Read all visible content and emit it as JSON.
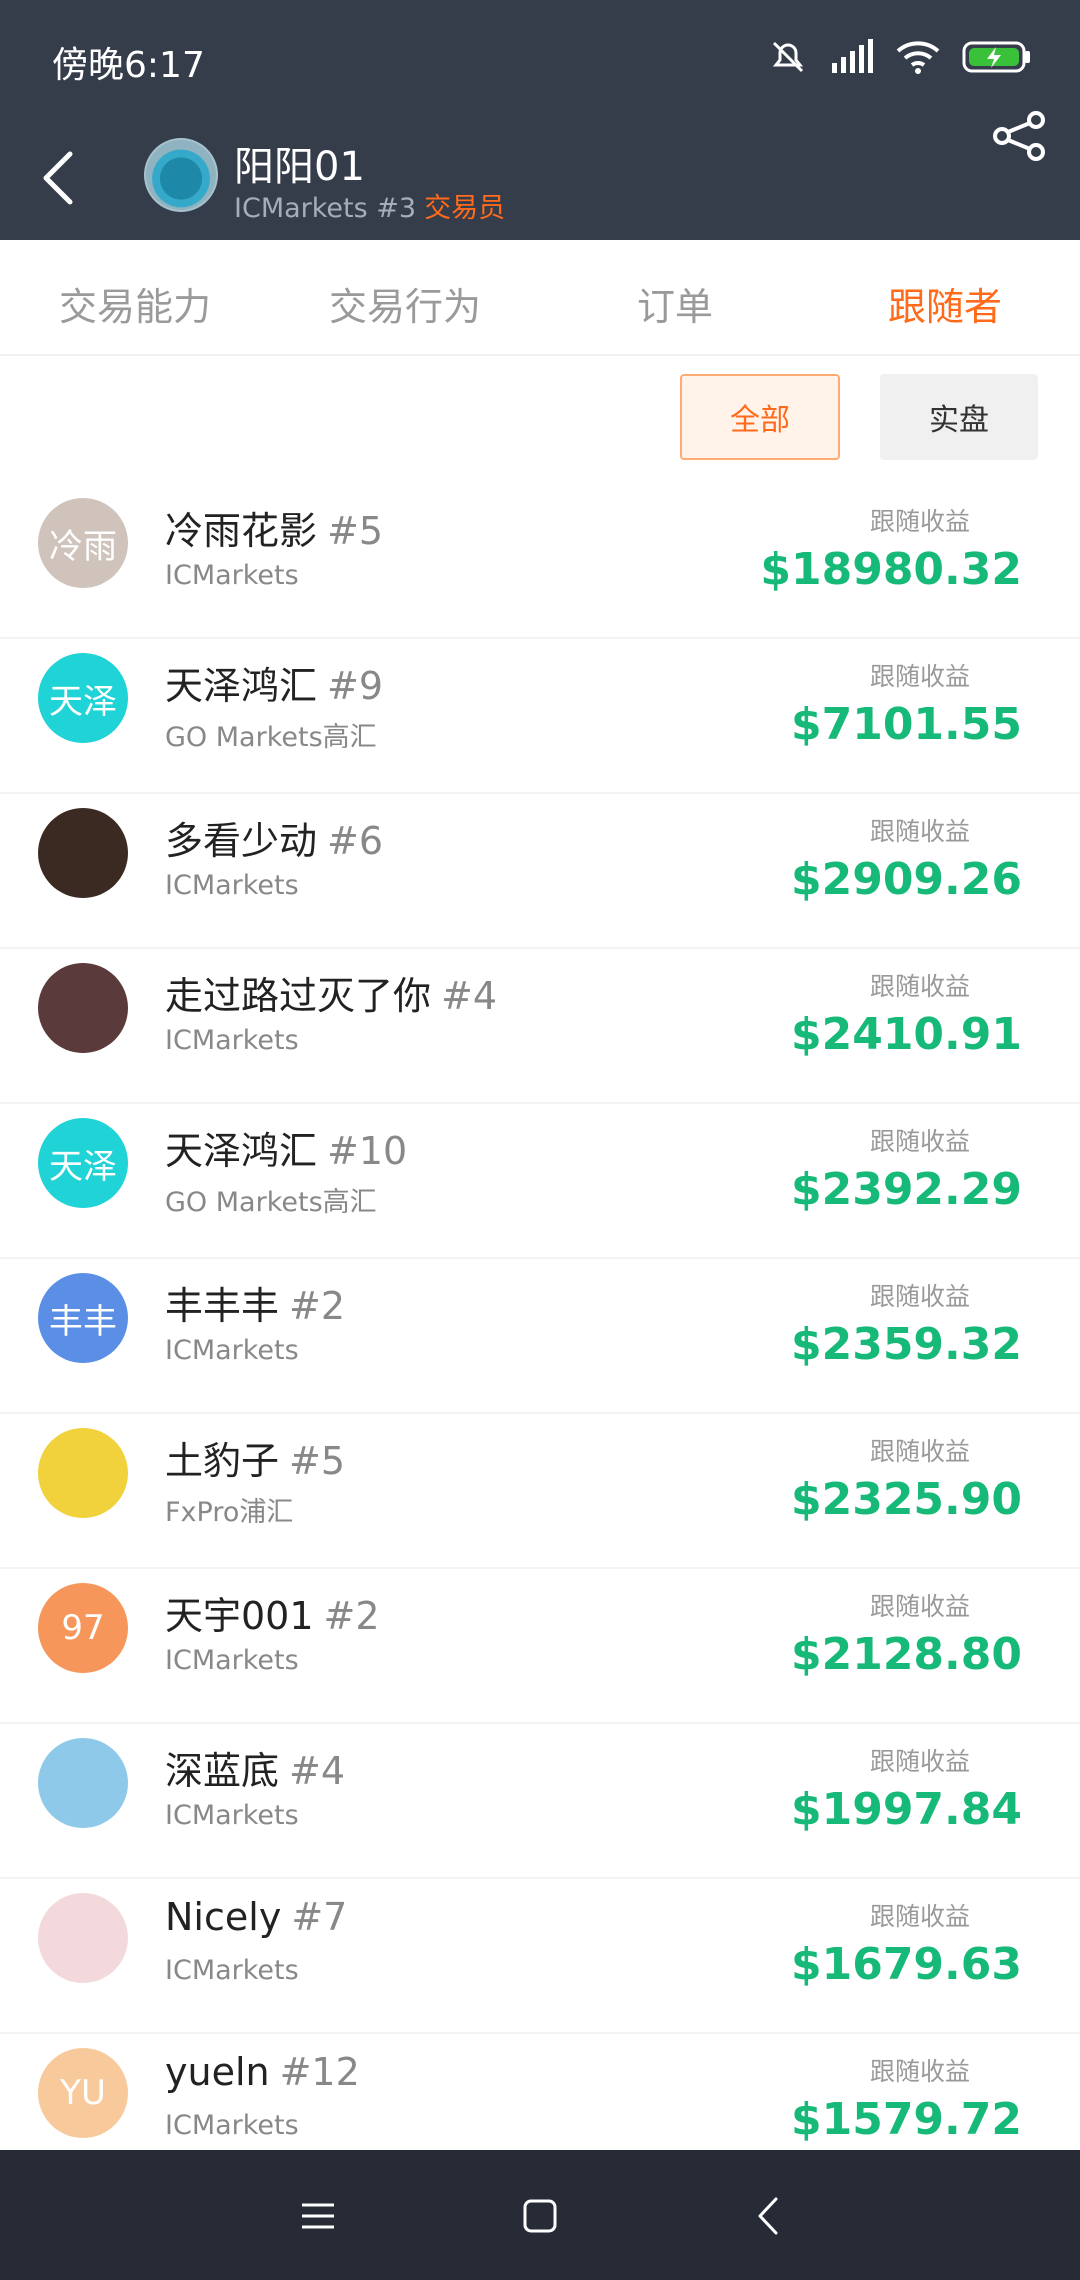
{
  "status": {
    "time": "傍晚6:17",
    "icons": [
      "mute-icon",
      "signal-icon",
      "wifi-icon",
      "battery-charging-icon"
    ]
  },
  "header": {
    "trader_name": "阳阳01",
    "broker_rank": "ICMarkets #3",
    "role": "交易员"
  },
  "tabs": [
    {
      "label": "交易能力",
      "active": false
    },
    {
      "label": "交易行为",
      "active": false
    },
    {
      "label": "订单",
      "active": false
    },
    {
      "label": "跟随者",
      "active": true
    }
  ],
  "filters": {
    "all": "全部",
    "real": "实盘"
  },
  "followers": [
    {
      "avatar_text": "冷雨",
      "avatar_color": "#cfc3bb",
      "name": "冷雨花影",
      "rank": "#5",
      "broker": "ICMarkets",
      "label": "跟随收益",
      "profit": "$18980.32"
    },
    {
      "avatar_text": "天泽",
      "avatar_color": "#1fd3d6",
      "name": "天泽鸿汇",
      "rank": "#9",
      "broker": "GO Markets高汇",
      "label": "跟随收益",
      "profit": "$7101.55"
    },
    {
      "avatar_text": "",
      "avatar_color": "#3a2a22",
      "name": "多看少动",
      "rank": "#6",
      "broker": "ICMarkets",
      "label": "跟随收益",
      "profit": "$2909.26"
    },
    {
      "avatar_text": "",
      "avatar_color": "#5a3a3a",
      "name": "走过路过灭了你",
      "rank": "#4",
      "broker": "ICMarkets",
      "label": "跟随收益",
      "profit": "$2410.91"
    },
    {
      "avatar_text": "天泽",
      "avatar_color": "#1fd3d6",
      "name": "天泽鸿汇",
      "rank": "#10",
      "broker": "GO Markets高汇",
      "label": "跟随收益",
      "profit": "$2392.29"
    },
    {
      "avatar_text": "丰丰",
      "avatar_color": "#5b8fe6",
      "name": "丰丰丰",
      "rank": "#2",
      "broker": "ICMarkets",
      "label": "跟随收益",
      "profit": "$2359.32"
    },
    {
      "avatar_text": "",
      "avatar_color": "#f2d23c",
      "name": "土豹子",
      "rank": "#5",
      "broker": "FxPro浦汇",
      "label": "跟随收益",
      "profit": "$2325.90"
    },
    {
      "avatar_text": "97",
      "avatar_color": "#f6965a",
      "name": "天宇001",
      "rank": "#2",
      "broker": "ICMarkets",
      "label": "跟随收益",
      "profit": "$2128.80"
    },
    {
      "avatar_text": "",
      "avatar_color": "#8ec9ea",
      "name": "深蓝底",
      "rank": "#4",
      "broker": "ICMarkets",
      "label": "跟随收益",
      "profit": "$1997.84"
    },
    {
      "avatar_text": "",
      "avatar_color": "#f4d9dc",
      "name": "Nicely",
      "rank": "#7",
      "broker": "ICMarkets",
      "label": "跟随收益",
      "profit": "$1679.63"
    },
    {
      "avatar_text": "YU",
      "avatar_color": "#f8c99a",
      "name": "yueln",
      "rank": "#12",
      "broker": "ICMarkets",
      "label": "跟随收益",
      "profit": "$1579.72"
    }
  ]
}
